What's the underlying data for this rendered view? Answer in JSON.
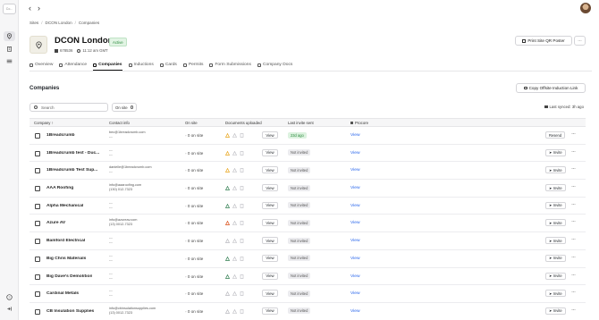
{
  "sidebar": {
    "logo_text": "Co...",
    "icons": [
      "map-pin-icon",
      "building-icon",
      "list-icon",
      "help-icon",
      "collapse-icon"
    ]
  },
  "nav": {
    "back": "‹",
    "forward": "›"
  },
  "breadcrumb": [
    "Sites",
    "DCON London",
    "Companies"
  ],
  "site": {
    "title": "DCON London",
    "status": "Active",
    "code": "678536",
    "time": "11:12 am GMT"
  },
  "header_actions": {
    "print_qr": "Print Site QR Poster",
    "more": "···"
  },
  "tabs": [
    "Overview",
    "Attendance",
    "Companies",
    "Inductions",
    "Cards",
    "Permits",
    "Form Submissions",
    "Company Docs"
  ],
  "active_tab": 2,
  "section": {
    "title": "Companies",
    "copy_link": "Copy Offsite Induction Link",
    "search_placeholder": "Search",
    "filter_chip": "On site",
    "last_synced": "Last synced: 3h ago"
  },
  "columns": [
    "Company",
    "Contact info",
    "On site",
    "Documents uploaded",
    "Last invite sent",
    "Procore"
  ],
  "rows": [
    {
      "name": "1Breadcrumb",
      "contact1": "bec@1breadcrumb.com",
      "contact2": "---",
      "onsite": "0 on site",
      "docs": [
        "warn",
        "grey",
        "grey"
      ],
      "invite": "23d ago",
      "invite_type": "green",
      "procore": "View",
      "action": "Resend"
    },
    {
      "name": "1Breadcrumb test - Duc...",
      "contact1": "---",
      "contact2": "---",
      "onsite": "0 on site",
      "docs": [
        "warn",
        "grey",
        "grey"
      ],
      "invite": "Not invited",
      "invite_type": "grey",
      "procore": "View",
      "action": "Invite"
    },
    {
      "name": "1Breadcrumb Test Sup...",
      "contact1": "danielle@1breadcrumb.com",
      "contact2": "---",
      "onsite": "0 on site",
      "docs": [
        "warn",
        "grey",
        "grey"
      ],
      "invite": "Not invited",
      "invite_type": "grey",
      "procore": "View",
      "action": "Invite"
    },
    {
      "name": "AAA Roofing",
      "contact1": "info@aaaroofing.com",
      "contact2": "(130) 012-7323",
      "onsite": "0 on site",
      "docs": [
        "ok",
        "grey",
        "grey"
      ],
      "invite": "Not invited",
      "invite_type": "grey",
      "procore": "View",
      "action": "Invite"
    },
    {
      "name": "Alpha Mechanical",
      "contact1": "---",
      "contact2": "---",
      "onsite": "0 on site",
      "docs": [
        "ok",
        "grey",
        "grey"
      ],
      "invite": "Not invited",
      "invite_type": "grey",
      "procore": "View",
      "action": "Invite"
    },
    {
      "name": "Azure AV",
      "contact1": "info@azureav.com",
      "contact2": "(13) 0012-7323",
      "onsite": "0 on site",
      "docs": [
        "err",
        "grey",
        "grey"
      ],
      "invite": "Not invited",
      "invite_type": "grey",
      "procore": "View",
      "action": "Invite"
    },
    {
      "name": "Bamford Electrical",
      "contact1": "---",
      "contact2": "---",
      "onsite": "0 on site",
      "docs": [
        "grey",
        "grey",
        "grey"
      ],
      "invite": "Not invited",
      "invite_type": "grey",
      "procore": "View",
      "action": "Invite"
    },
    {
      "name": "Big Chris Materials",
      "contact1": "---",
      "contact2": "---",
      "onsite": "0 on site",
      "docs": [
        "ok",
        "grey",
        "grey"
      ],
      "invite": "Not invited",
      "invite_type": "grey",
      "procore": "View",
      "action": "Invite"
    },
    {
      "name": "Big Dave's Demolition",
      "contact1": "---",
      "contact2": "---",
      "onsite": "0 on site",
      "docs": [
        "ok",
        "grey",
        "grey"
      ],
      "invite": "Not invited",
      "invite_type": "grey",
      "procore": "View",
      "action": "Invite"
    },
    {
      "name": "Cardinal Metals",
      "contact1": "---",
      "contact2": "---",
      "onsite": "0 on site",
      "docs": [
        "grey",
        "grey",
        "grey"
      ],
      "invite": "Not invited",
      "invite_type": "grey",
      "procore": "View",
      "action": "Invite"
    },
    {
      "name": "CB Insulation Supplies",
      "contact1": "info@cbinsulationsupplies.com",
      "contact2": "(13) 0012-7323",
      "onsite": "0 on site",
      "docs": [
        "grey",
        "grey",
        "grey"
      ],
      "invite": "Not invited",
      "invite_type": "grey",
      "procore": "View",
      "action": "Invite"
    }
  ],
  "colors": {
    "accent_link": "#2563eb",
    "active_badge": "#2b8a3e",
    "warn": "#e8a317",
    "ok": "#2f7d4f",
    "err": "#d9480f"
  }
}
